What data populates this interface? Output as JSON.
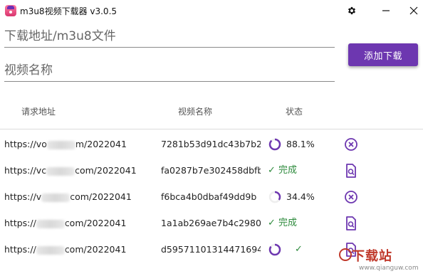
{
  "window": {
    "title": "m3u8视频下载器 v3.0.5",
    "icon": "app-icon",
    "settings_icon": "gear-icon",
    "minimize_icon": "minimize-icon",
    "close_icon": "close-icon"
  },
  "form": {
    "url_placeholder": "下载地址/m3u8文件",
    "name_placeholder": "视频名称",
    "download_label": "添加下载",
    "accent": "#6d37b0"
  },
  "table": {
    "headers": {
      "url": "请求地址",
      "name": "视频名称",
      "status": "状态"
    },
    "rows": [
      {
        "url_prefix": "https://vo",
        "url_suffix": "m/2022041",
        "name": "7281b53d91dc43b7b2",
        "status": "88.1%",
        "progress": 0.881,
        "state": "downloading",
        "action_icon": "cancel-circle-icon"
      },
      {
        "url_prefix": "https://vc",
        "url_suffix": "com/2022041",
        "name": "fa0287b7e302458dbfb",
        "status": "✓ 完成",
        "progress": 1.0,
        "state": "complete",
        "action_icon": "file-search-icon"
      },
      {
        "url_prefix": "https://v",
        "url_suffix": "com/2022041",
        "name": "f6bca4b0dbaf49dd9b",
        "status": "34.4%",
        "progress": 0.344,
        "state": "downloading",
        "action_icon": "cancel-circle-icon"
      },
      {
        "url_prefix": "https://",
        "url_suffix": "com/2022041",
        "name": "1a1ab269ae7b4c2980",
        "status": "✓ 完成",
        "progress": 1.0,
        "state": "complete",
        "action_icon": "file-search-icon"
      },
      {
        "url_prefix": "https://",
        "url_suffix": "com/2022041",
        "name": "d59571101314471694",
        "status": "✓",
        "progress": 0.85,
        "state": "merging",
        "action_icon": "file-search-icon"
      }
    ]
  },
  "watermark": {
    "text": "下载站",
    "url": "www.qianguw.com"
  },
  "colors": {
    "progress": "#6d37b0",
    "check": "#2e8b3d",
    "divider": "#dcdcdc"
  }
}
